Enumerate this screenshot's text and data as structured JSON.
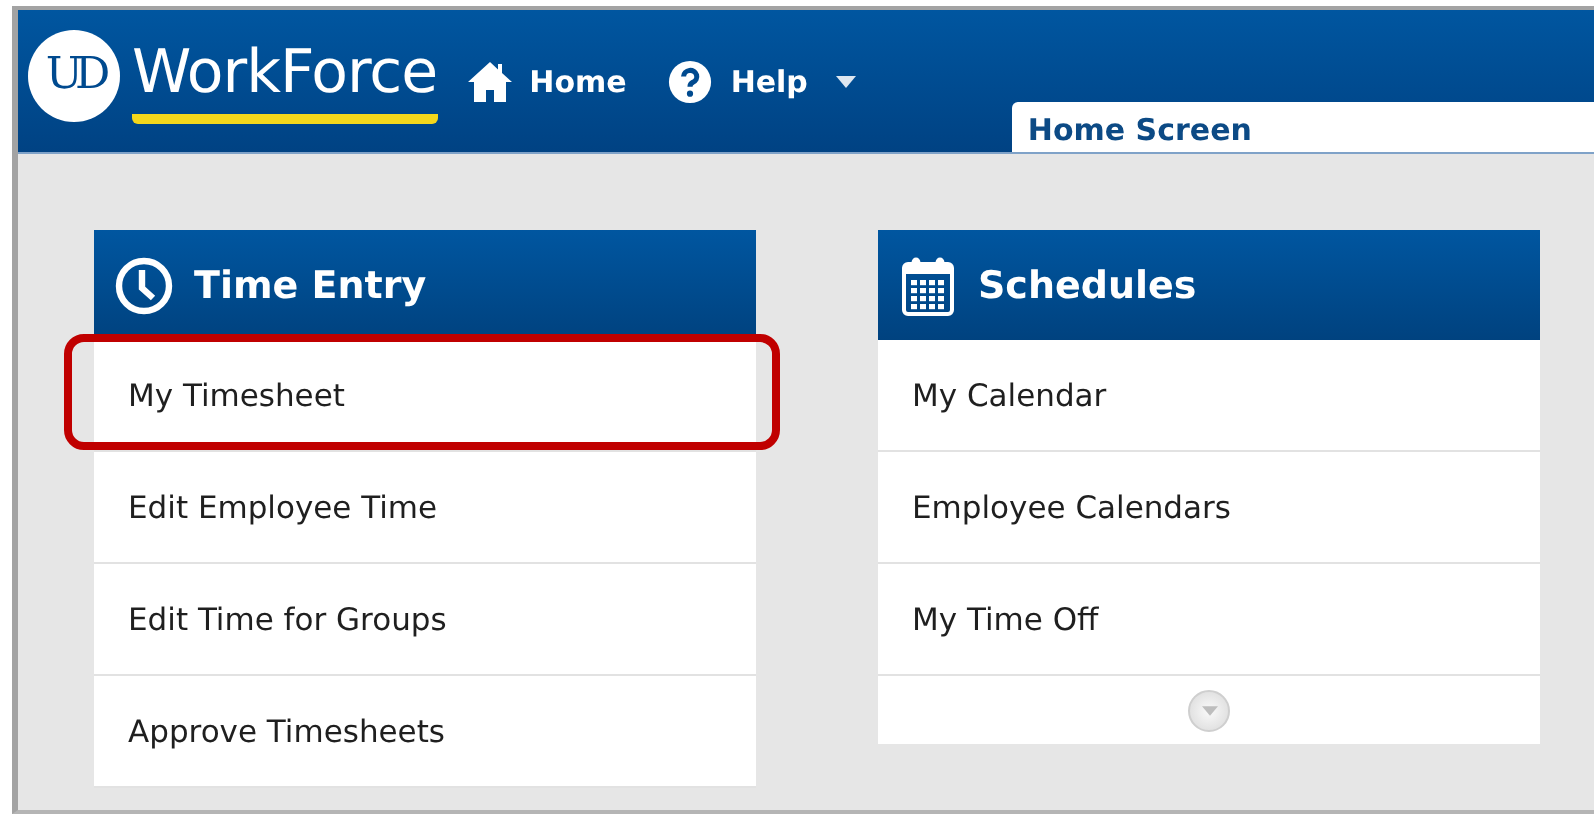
{
  "header": {
    "logo_mark": "UD",
    "logo_text": "WorkForce",
    "nav": [
      {
        "kind": "home",
        "label": "Home"
      },
      {
        "kind": "help",
        "label": "Help",
        "dropdown": true
      }
    ],
    "tab": {
      "label": "Home Screen",
      "selected": true
    }
  },
  "cards": [
    {
      "kind": "clock",
      "title": "Time Entry",
      "items": [
        {
          "label": "My Timesheet",
          "highlighted": true
        },
        {
          "label": "Edit Employee Time",
          "highlighted": false
        },
        {
          "label": "Edit Time for Groups",
          "highlighted": false
        },
        {
          "label": "Approve Timesheets",
          "highlighted": false
        }
      ]
    },
    {
      "kind": "calendar",
      "title": "Schedules",
      "items": [
        {
          "label": "My Calendar",
          "highlighted": false
        },
        {
          "label": "Employee Calendars",
          "highlighted": false
        },
        {
          "label": "My Time Off",
          "highlighted": false
        }
      ],
      "more": true
    }
  ]
}
